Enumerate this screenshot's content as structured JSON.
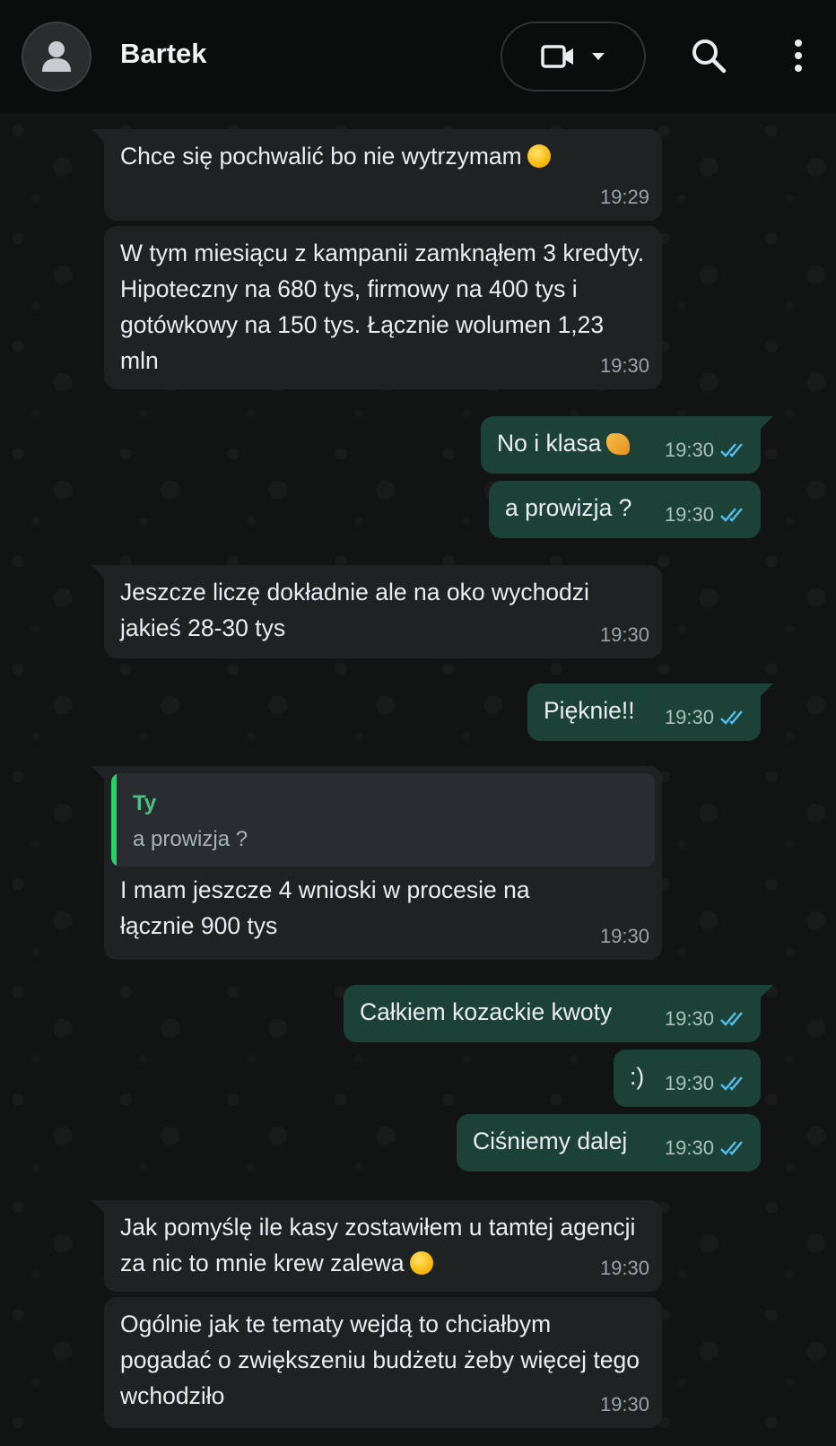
{
  "header": {
    "contact_name": "Bartek"
  },
  "messages": [
    {
      "direction": "in",
      "text": "Chce się pochwalić bo nie wytrzymam",
      "emoji": "joy-emoji",
      "time": "19:29"
    },
    {
      "direction": "in",
      "text": "W tym miesiącu z kampanii zamknąłem 3 kredyty. Hipoteczny na 680 tys, firmowy na 400 tys i gotówkowy na 150 tys. Łącznie wolumen 1,23 mln",
      "time": "19:30"
    },
    {
      "direction": "out",
      "text": "No i klasa",
      "emoji": "flexed-biceps-emoji",
      "time": "19:30",
      "status": "read"
    },
    {
      "direction": "out",
      "text": "a prowizja ?",
      "time": "19:30",
      "status": "read"
    },
    {
      "direction": "in",
      "text": "Jeszcze liczę dokładnie ale na oko wychodzi jakieś 28-30 tys",
      "time": "19:30"
    },
    {
      "direction": "out",
      "text": "Pięknie!!",
      "time": "19:30",
      "status": "read"
    },
    {
      "direction": "in",
      "quote": {
        "author": "Ty",
        "text": "a prowizja ?"
      },
      "text": "I mam jeszcze 4 wnioski w procesie na łącznie 900 tys",
      "time": "19:30"
    },
    {
      "direction": "out",
      "text": "Całkiem kozackie kwoty",
      "time": "19:30",
      "status": "read"
    },
    {
      "direction": "out",
      "text": ":)",
      "time": "19:30",
      "status": "read"
    },
    {
      "direction": "out",
      "text": "Ciśniemy dalej",
      "time": "19:30",
      "status": "read"
    },
    {
      "direction": "in",
      "text": "Jak pomyślę ile kasy zostawiłem u tamtej agencji za nic to mnie krew zalewa",
      "emoji": "upside-down-face-emoji",
      "time": "19:30"
    },
    {
      "direction": "in",
      "text": "Ogólnie jak te tematy wejdą to chciałbym pogadać o zwiększeniu budżetu żeby więcej tego wchodziło",
      "time": "19:30"
    }
  ],
  "colors": {
    "incoming_bubble": "#1f2223",
    "outgoing_bubble": "#1c4137",
    "read_ticks": "#53bdeb",
    "quote_accent": "#25d366"
  }
}
